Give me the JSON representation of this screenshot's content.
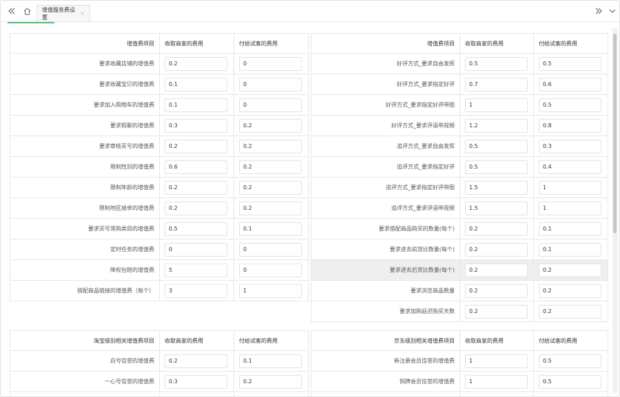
{
  "tab": {
    "title": "增值服务费设置",
    "close": "×"
  },
  "col_merchant": "收取商家的费用",
  "col_tester": "付给试客的费用",
  "left": {
    "header": "增值费项目",
    "rows": [
      {
        "label": "要求收藏店铺的增值费",
        "merchant": "0.2",
        "tester": "0"
      },
      {
        "label": "要求收藏宝贝的增值费",
        "merchant": "0.1",
        "tester": "0"
      },
      {
        "label": "要求加入购物车的增值费",
        "merchant": "0.1",
        "tester": "0"
      },
      {
        "label": "要求假聊的增值费",
        "merchant": "0.3",
        "tester": "0.2"
      },
      {
        "label": "要求审核买号的增值费",
        "merchant": "0.2",
        "tester": "0.2"
      },
      {
        "label": "限制性别的增值费",
        "merchant": "0.6",
        "tester": "0.2"
      },
      {
        "label": "限制年龄的增值费",
        "merchant": "0.2",
        "tester": "0.2"
      },
      {
        "label": "限制地区接单的增值费",
        "merchant": "0.2",
        "tester": "0.2"
      },
      {
        "label": "要求买号常购类目的增值费",
        "merchant": "0.5",
        "tester": "0.1"
      },
      {
        "label": "定时任务的增值费",
        "merchant": "0",
        "tester": "0"
      },
      {
        "label": "降权包赔的增值费",
        "merchant": "5",
        "tester": "0"
      },
      {
        "label": "搭配商品链接的增值费（每个）",
        "merchant": "3",
        "tester": "1"
      }
    ]
  },
  "right": {
    "header": "增值费项目",
    "rows": [
      {
        "label": "好评方式_要求自由发挥",
        "merchant": "0.5",
        "tester": "0.5"
      },
      {
        "label": "好评方式_要求指定好评",
        "merchant": "0.7",
        "tester": "0.6"
      },
      {
        "label": "好评方式_要求指定好评带图",
        "merchant": "1",
        "tester": "0.5"
      },
      {
        "label": "好评方式_要求评语带视频",
        "merchant": "1.2",
        "tester": "0.8"
      },
      {
        "label": "追评方式_要求自由发挥",
        "merchant": "0.5",
        "tester": "0.3"
      },
      {
        "label": "追评方式_要求指定好评",
        "merchant": "0.5",
        "tester": "0.4"
      },
      {
        "label": "追评方式_要求指定好评带图",
        "merchant": "1.5",
        "tester": "1"
      },
      {
        "label": "追评方式_要求评语带视频",
        "merchant": "1.5",
        "tester": "1"
      },
      {
        "label": "要求搭配商品购买的数量(每个)",
        "merchant": "0.2",
        "tester": "0.1"
      },
      {
        "label": "要求进去前货比数量(每个)",
        "merchant": "0.2",
        "tester": "0.1"
      },
      {
        "label": "要求进去后货比数量(每个)",
        "merchant": "0.2",
        "tester": "0.2"
      },
      {
        "label": "要求浏览商品数量",
        "merchant": "0.2",
        "tester": "0.2"
      },
      {
        "label": "要求加购延迟购买天数",
        "merchant": "0.2",
        "tester": "0.2"
      }
    ]
  },
  "taobao": {
    "header": "淘宝级别相关增值费项目",
    "rows": [
      {
        "label": "白号信誉的增值费",
        "merchant": "0.2",
        "tester": "0.1"
      },
      {
        "label": "一心号信誉的增值费",
        "merchant": "0.3",
        "tester": "0.2"
      }
    ]
  },
  "jd": {
    "header": "京东级别相关增值费项目",
    "rows": [
      {
        "label": "新注册会员信誉的增值费",
        "merchant": "1",
        "tester": "0.5"
      },
      {
        "label": "铜牌会员信誉的增值费",
        "merchant": "1",
        "tester": "0.5"
      }
    ]
  }
}
